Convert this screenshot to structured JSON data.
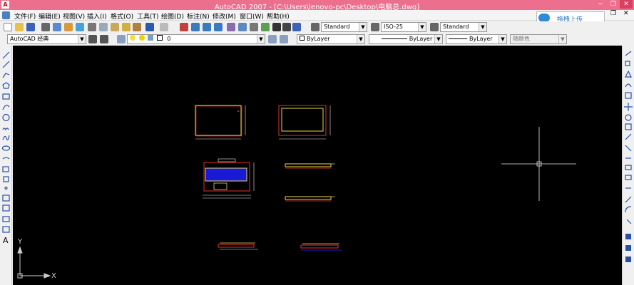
{
  "title": "AutoCAD 2007 - [C:\\Users\\lenovo-pc\\Desktop\\电脑总.dwg]",
  "window": {
    "minimize": "−",
    "restore": "❐",
    "close": "✕"
  },
  "menu": [
    "文件(F)",
    "编辑(E)",
    "视图(V)",
    "插入(I)",
    "格式(O)",
    "工具(T)",
    "绘图(D)",
    "标注(N)",
    "修改(M)",
    "窗口(W)",
    "帮助(H)"
  ],
  "menu_right": {
    "minimize": "−",
    "restore": "❐",
    "close": "✕"
  },
  "upload_button": "拖拽上传",
  "styles_toolbar": {
    "text_style": "Standard",
    "dim_style": "ISO-25",
    "table_style": "Standard"
  },
  "workspace": "AutoCAD 经典",
  "layer": "0",
  "properties": {
    "color": "ByLayer",
    "linetype": "ByLayer",
    "lineweight": "ByLayer",
    "plotstyle": "随颜色"
  },
  "ucs": {
    "x": "X",
    "y": "Y"
  },
  "colors": {
    "titlebar": "#ec6f8e",
    "canvas": "#000000",
    "keyboard": "#1a1ad6",
    "outline_yellow": "#e8d84a",
    "outline_red": "#e03030"
  }
}
